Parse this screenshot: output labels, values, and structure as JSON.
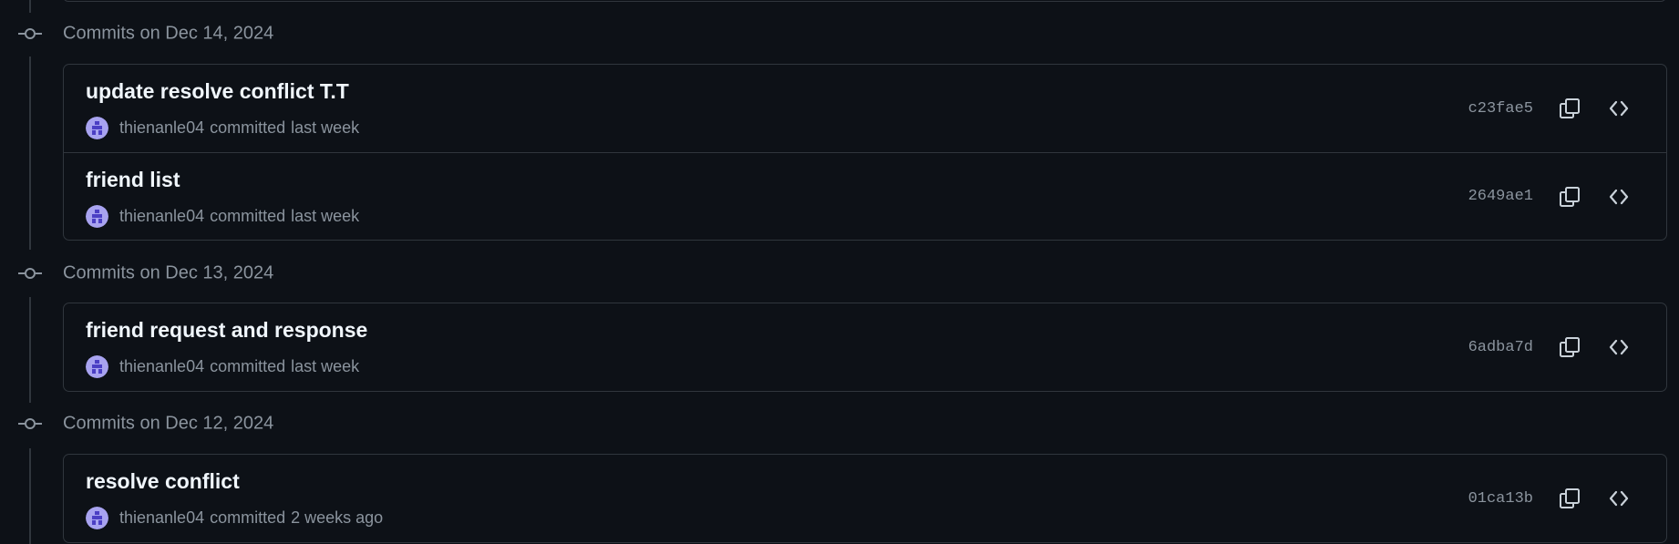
{
  "groups": [
    {
      "date_label": "Commits on Dec 14, 2024",
      "commits": [
        {
          "title": "update resolve conflict T.T",
          "author": "thienanle04",
          "action": "committed",
          "time": "last week",
          "sha": "c23fae5"
        },
        {
          "title": "friend list",
          "author": "thienanle04",
          "action": "committed",
          "time": "last week",
          "sha": "2649ae1"
        }
      ]
    },
    {
      "date_label": "Commits on Dec 13, 2024",
      "commits": [
        {
          "title": "friend request and response",
          "author": "thienanle04",
          "action": "committed",
          "time": "last week",
          "sha": "6adba7d"
        }
      ]
    },
    {
      "date_label": "Commits on Dec 12, 2024",
      "commits": [
        {
          "title": "resolve conflict",
          "author": "thienanle04",
          "action": "committed",
          "time": "2 weeks ago",
          "sha": "01ca13b"
        }
      ]
    }
  ],
  "icons": {
    "commit": "git-commit-icon",
    "copy": "copy-icon",
    "browse": "code-icon",
    "avatar": "avatar"
  },
  "colors": {
    "background": "#0d1117",
    "border": "#30363d",
    "muted_text": "#8b949e",
    "title_text": "#f0f6fc",
    "avatar_bg": "#a8a3f0",
    "avatar_fg": "#4b3fc4"
  }
}
